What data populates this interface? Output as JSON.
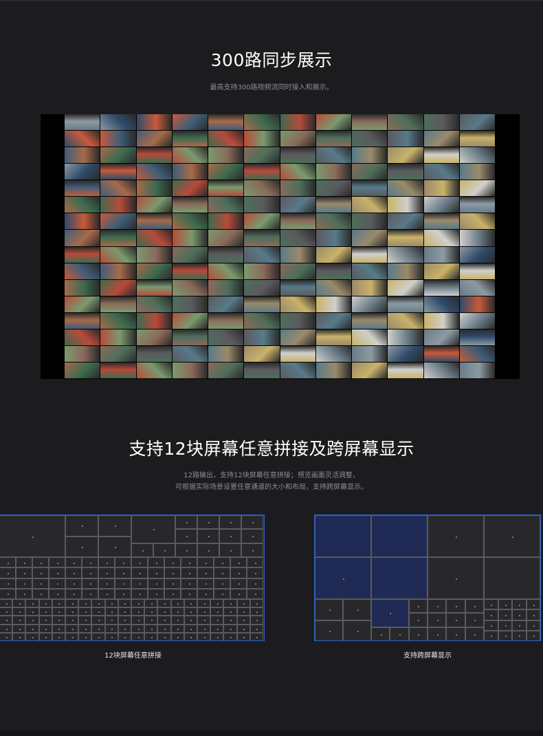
{
  "section1": {
    "title": "300路同步展示",
    "subtitle": "最高支持300路视频流同时接入和展示。"
  },
  "video_wall": {
    "rows": 16,
    "cols": 12,
    "palette": [
      "#6a7c88",
      "#9a8a6a",
      "#4e6e5a",
      "#b84a3a",
      "#3f5d78",
      "#8c9aa2",
      "#c9b26a",
      "#5a5a5e",
      "#7a9a6e",
      "#a76a4a",
      "#2e4a6a",
      "#d0d0cc",
      "#587a8a",
      "#8a6a5a",
      "#3d6a4e",
      "#c85a3a"
    ]
  },
  "section2": {
    "title": "支持12块屏幕任意拼接及跨屏幕显示",
    "subtitle_line1": "12路输出，支持12块屏幕任意拼接；预览画面灵活调整，",
    "subtitle_line2": "可根据实际场景设置任意通道的大小和布局，支持跨屏幕显示。"
  },
  "diagrams": {
    "left_caption": "12块屏幕任意拼接",
    "right_caption": "支持跨屏幕显示"
  },
  "colors": {
    "background": "#1c1c1f",
    "panel_border": "#2e62d8",
    "panel_fill": "#28282b",
    "highlight_fill": "#1f2a55"
  }
}
